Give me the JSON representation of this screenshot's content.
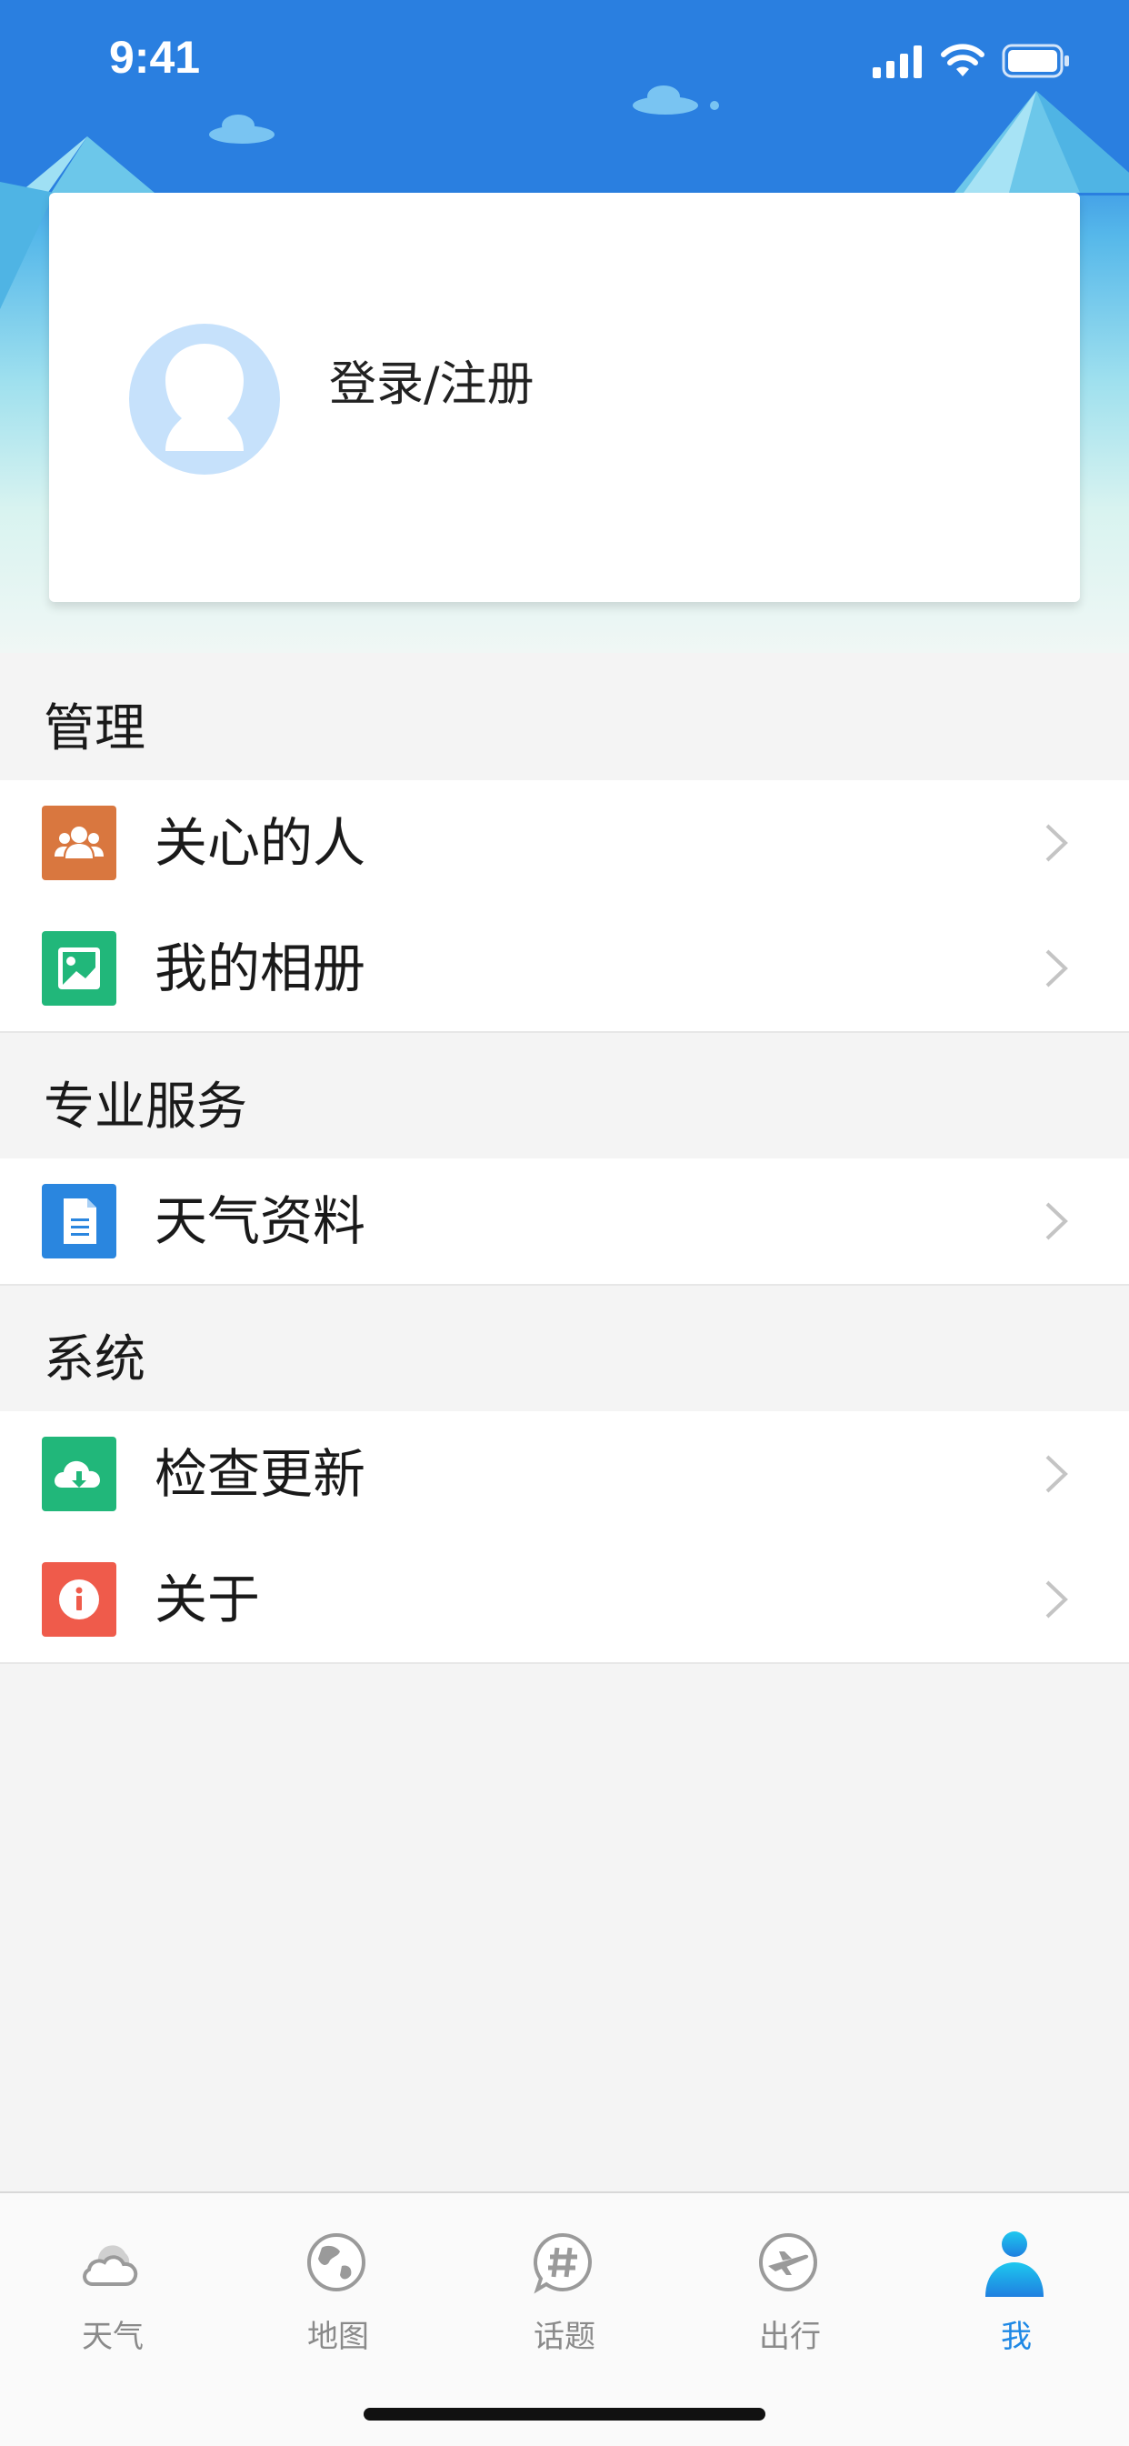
{
  "status_bar": {
    "time": "9:41"
  },
  "profile": {
    "login_label": "登录/注册"
  },
  "sections": [
    {
      "title": "管理",
      "items": [
        {
          "label": "关心的人",
          "icon": "people-icon",
          "color": "#d9773f"
        },
        {
          "label": "我的相册",
          "icon": "photo-icon",
          "color": "#21b77a"
        }
      ]
    },
    {
      "title": "专业服务",
      "items": [
        {
          "label": "天气资料",
          "icon": "document-icon",
          "color": "#2a86df"
        }
      ]
    },
    {
      "title": "系统",
      "items": [
        {
          "label": "检查更新",
          "icon": "cloud-download-icon",
          "color": "#21b77a"
        },
        {
          "label": "关于",
          "icon": "info-icon",
          "color": "#ef5b4b"
        }
      ]
    }
  ],
  "tabbar": {
    "tabs": [
      {
        "label": "天气",
        "icon": "cloud-icon"
      },
      {
        "label": "地图",
        "icon": "globe-icon"
      },
      {
        "label": "话题",
        "icon": "hashtag-icon"
      },
      {
        "label": "出行",
        "icon": "airplane-icon"
      },
      {
        "label": "我",
        "icon": "person-icon"
      }
    ],
    "active_index": 4
  },
  "colors": {
    "header_blue": "#2a7fe0",
    "accent": "#1e88e5"
  }
}
